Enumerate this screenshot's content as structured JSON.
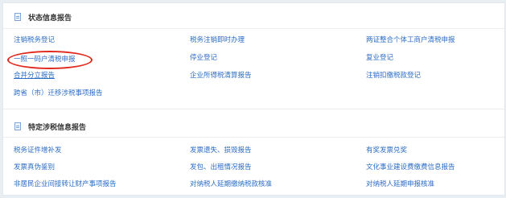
{
  "section1": {
    "title": "状态信息报告",
    "col1": [
      "注销税务登记",
      "一照一码户清税申报",
      "合并分立报告",
      "跨省（市）迁移涉税事项报告"
    ],
    "col2": [
      "税务注销即时办理",
      "停业登记",
      "企业所得税清算报告"
    ],
    "col3": [
      "两证整合个体工商户清税申报",
      "复业登记",
      "注销扣缴税款登记"
    ]
  },
  "section2": {
    "title": "特定涉税信息报告",
    "col1": [
      "税务证件增补发",
      "发票真伪鉴别",
      "非居民企业间接转让财产事项报告"
    ],
    "col2": [
      "发票遗失、损毁报告",
      "发包、出租情况报告",
      "对纳税人延期缴纳税款核准"
    ],
    "col3": [
      "有奖发票兑奖",
      "文化事业建设费缴费信息报告",
      "对纳税人延期申报核准"
    ]
  },
  "colors": {
    "link": "#2b6cc4",
    "highlight": "#e0281d",
    "background": "#e9eef3"
  }
}
